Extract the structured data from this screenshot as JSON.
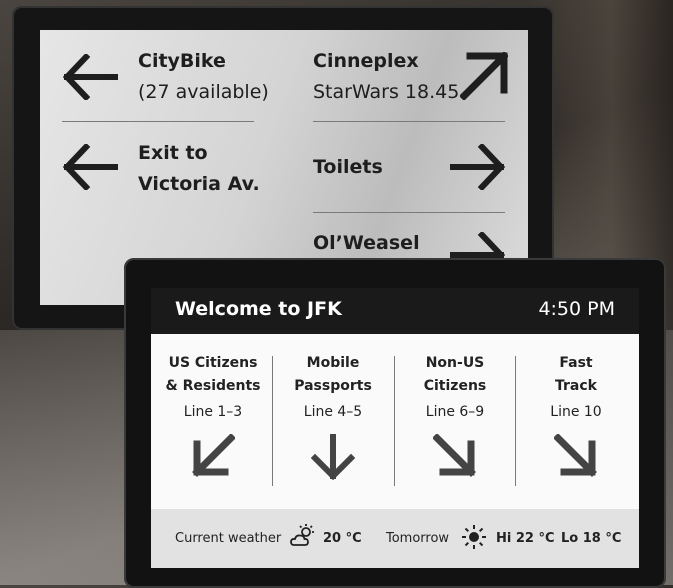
{
  "back_sign": {
    "citybike": {
      "title": "CityBike",
      "sub": "(27 available)"
    },
    "cinneplex": {
      "title": "Cinneplex",
      "sub": "StarWars 18.45"
    },
    "exit": {
      "line1": "Exit to",
      "line2": "Victoria Av."
    },
    "toilets": {
      "title": "Toilets"
    },
    "olweasel": {
      "title": "Ol’Weasel"
    }
  },
  "front": {
    "title": "Welcome to JFK",
    "time": "4:50 PM",
    "lanes": [
      {
        "name1": "US Citizens",
        "name2": "& Residents",
        "line": "Line 1–3",
        "arrow": "arrow-down-left"
      },
      {
        "name1": "Mobile",
        "name2": "Passports",
        "line": "Line 4–5",
        "arrow": "arrow-down"
      },
      {
        "name1": "Non-US",
        "name2": "Citizens",
        "line": "Line 6–9",
        "arrow": "arrow-down-right"
      },
      {
        "name1": "Fast",
        "name2": "Track",
        "line": "Line 10",
        "arrow": "arrow-down-right"
      }
    ],
    "weather": {
      "current_label": "Current weather",
      "current_icon": "partly-cloudy-icon",
      "current_temp": "20 °C",
      "tomorrow_label": "Tomorrow",
      "tomorrow_icon": "sun-icon",
      "hi": "Hi 22 °C",
      "lo": "Lo 18 °C"
    }
  }
}
